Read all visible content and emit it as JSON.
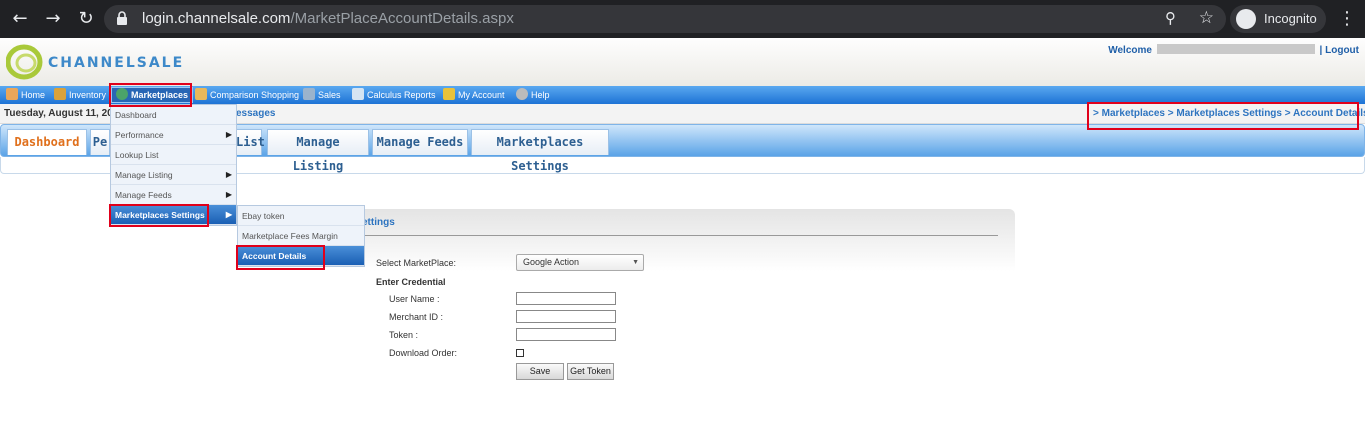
{
  "browser": {
    "url_host": "login.channelsale.com",
    "url_path": "/MarketPlaceAccountDetails.aspx",
    "profile_label": "Incognito"
  },
  "header": {
    "logo_text": "CHANNELSALE",
    "welcome_label": "Welcome",
    "separator": "|",
    "logout_label": "Logout"
  },
  "menu": {
    "items": [
      {
        "label": "Home",
        "icon": "home-icon"
      },
      {
        "label": "Inventory",
        "icon": "inventory-icon"
      },
      {
        "label": "Marketplaces",
        "icon": "globe-icon"
      },
      {
        "label": "Comparison Shopping",
        "icon": "folder-icon"
      },
      {
        "label": "Sales",
        "icon": "sales-icon"
      },
      {
        "label": "Calculus Reports",
        "icon": "chart-icon"
      },
      {
        "label": "My Account",
        "icon": "key-icon"
      },
      {
        "label": "Help",
        "icon": "help-icon"
      }
    ]
  },
  "daterow": {
    "date": "Tuesday, August 11, 2020",
    "messages_fragment": "essages",
    "breadcrumb": "> Marketplaces > Marketplaces Settings > Account Details"
  },
  "tabs": [
    {
      "label": "Dashboard"
    },
    {
      "label": "Pe"
    },
    {
      "label": "List"
    },
    {
      "label": "Manage Listing"
    },
    {
      "label": "Manage Feeds"
    },
    {
      "label": "Marketplaces Settings"
    }
  ],
  "dropdown_main": [
    {
      "label": "Dashboard",
      "arrow": ""
    },
    {
      "label": "Performance",
      "arrow": "▶"
    },
    {
      "label": "Lookup List",
      "arrow": ""
    },
    {
      "label": "Manage Listing",
      "arrow": "▶"
    },
    {
      "label": "Manage Feeds",
      "arrow": "▶"
    },
    {
      "label": "Marketplaces Settings",
      "arrow": "▶"
    }
  ],
  "dropdown_sub": [
    {
      "label": "Ebay token"
    },
    {
      "label": "Marketplace Fees Margin"
    },
    {
      "label": "Account Details"
    }
  ],
  "panel": {
    "title_fragment": "ettings",
    "select_label": "Select MarketPlace:",
    "select_value": "Google Action",
    "credential_heading": "Enter Credential",
    "username_label": "User Name :",
    "merchant_label": "Merchant ID :",
    "token_label": "Token :",
    "download_label": "Download Order:",
    "save_label": "Save",
    "get_token_label": "Get Token"
  },
  "colors": {
    "accent": "#2d74c0",
    "highlight": "#e0001b",
    "active_tab": "#e0701c"
  }
}
